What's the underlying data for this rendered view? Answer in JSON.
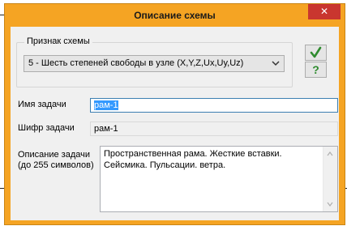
{
  "window": {
    "title": "Описание схемы",
    "close_glyph": "✕"
  },
  "scheme_group": {
    "label": "Признак схемы",
    "selected": "5 - Шесть степеней свободы в узле (X,Y,Z,Ux,Uy,Uz)"
  },
  "buttons": {
    "ok_icon": "checkmark-icon",
    "ok_color": "#2e8b2e",
    "help_glyph": "?",
    "help_color": "#2e8b2e"
  },
  "task_name": {
    "label": "Имя задачи",
    "value": "рам-1"
  },
  "task_code": {
    "label": "Шифр задачи",
    "value": "рам-1"
  },
  "description": {
    "label_line1": "Описание задачи",
    "label_line2": "(до 255 символов)",
    "value": "Пространственная рама. Жесткие вставки. Сейсмика. Пульсации. ветра."
  },
  "colors": {
    "title_bar": "#f5a423",
    "close_button": "#c9362f",
    "selection": "#3399ff"
  }
}
